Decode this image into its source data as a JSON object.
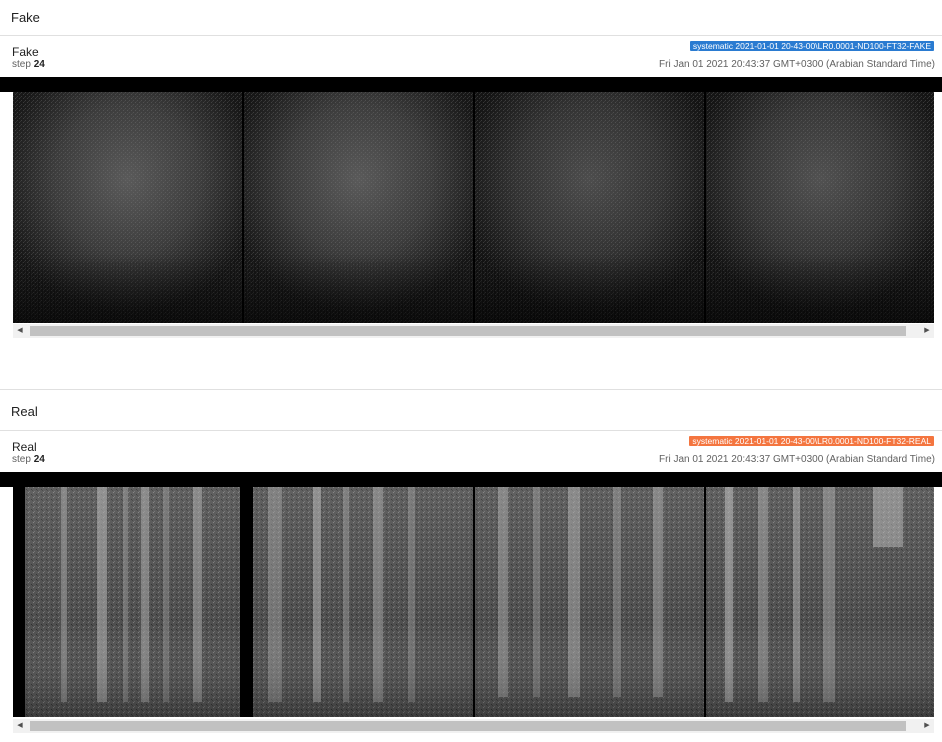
{
  "groups": [
    {
      "header": "Fake",
      "card_title": "Fake",
      "step_label": "step",
      "step_value": "24",
      "run_tag": "systematic 2021-01-01 20-43-00\\LR0.0001-ND100-FT32-FAKE",
      "run_tag_color": "#2a7bd1",
      "timestamp": "Fri Jan 01 2021 20:43:37 GMT+0300 (Arabian Standard Time)",
      "style": "fake"
    },
    {
      "header": "Real",
      "card_title": "Real",
      "step_label": "step",
      "step_value": "24",
      "run_tag": "systematic 2021-01-01 20-43-00\\LR0.0001-ND100-FT32-REAL",
      "run_tag_color": "#f4753f",
      "timestamp": "Fri Jan 01 2021 20:43:37 GMT+0300 (Arabian Standard Time)",
      "style": "real"
    }
  ],
  "icons": {
    "scroll_left": "triangle-left-icon",
    "scroll_right": "triangle-right-icon"
  }
}
